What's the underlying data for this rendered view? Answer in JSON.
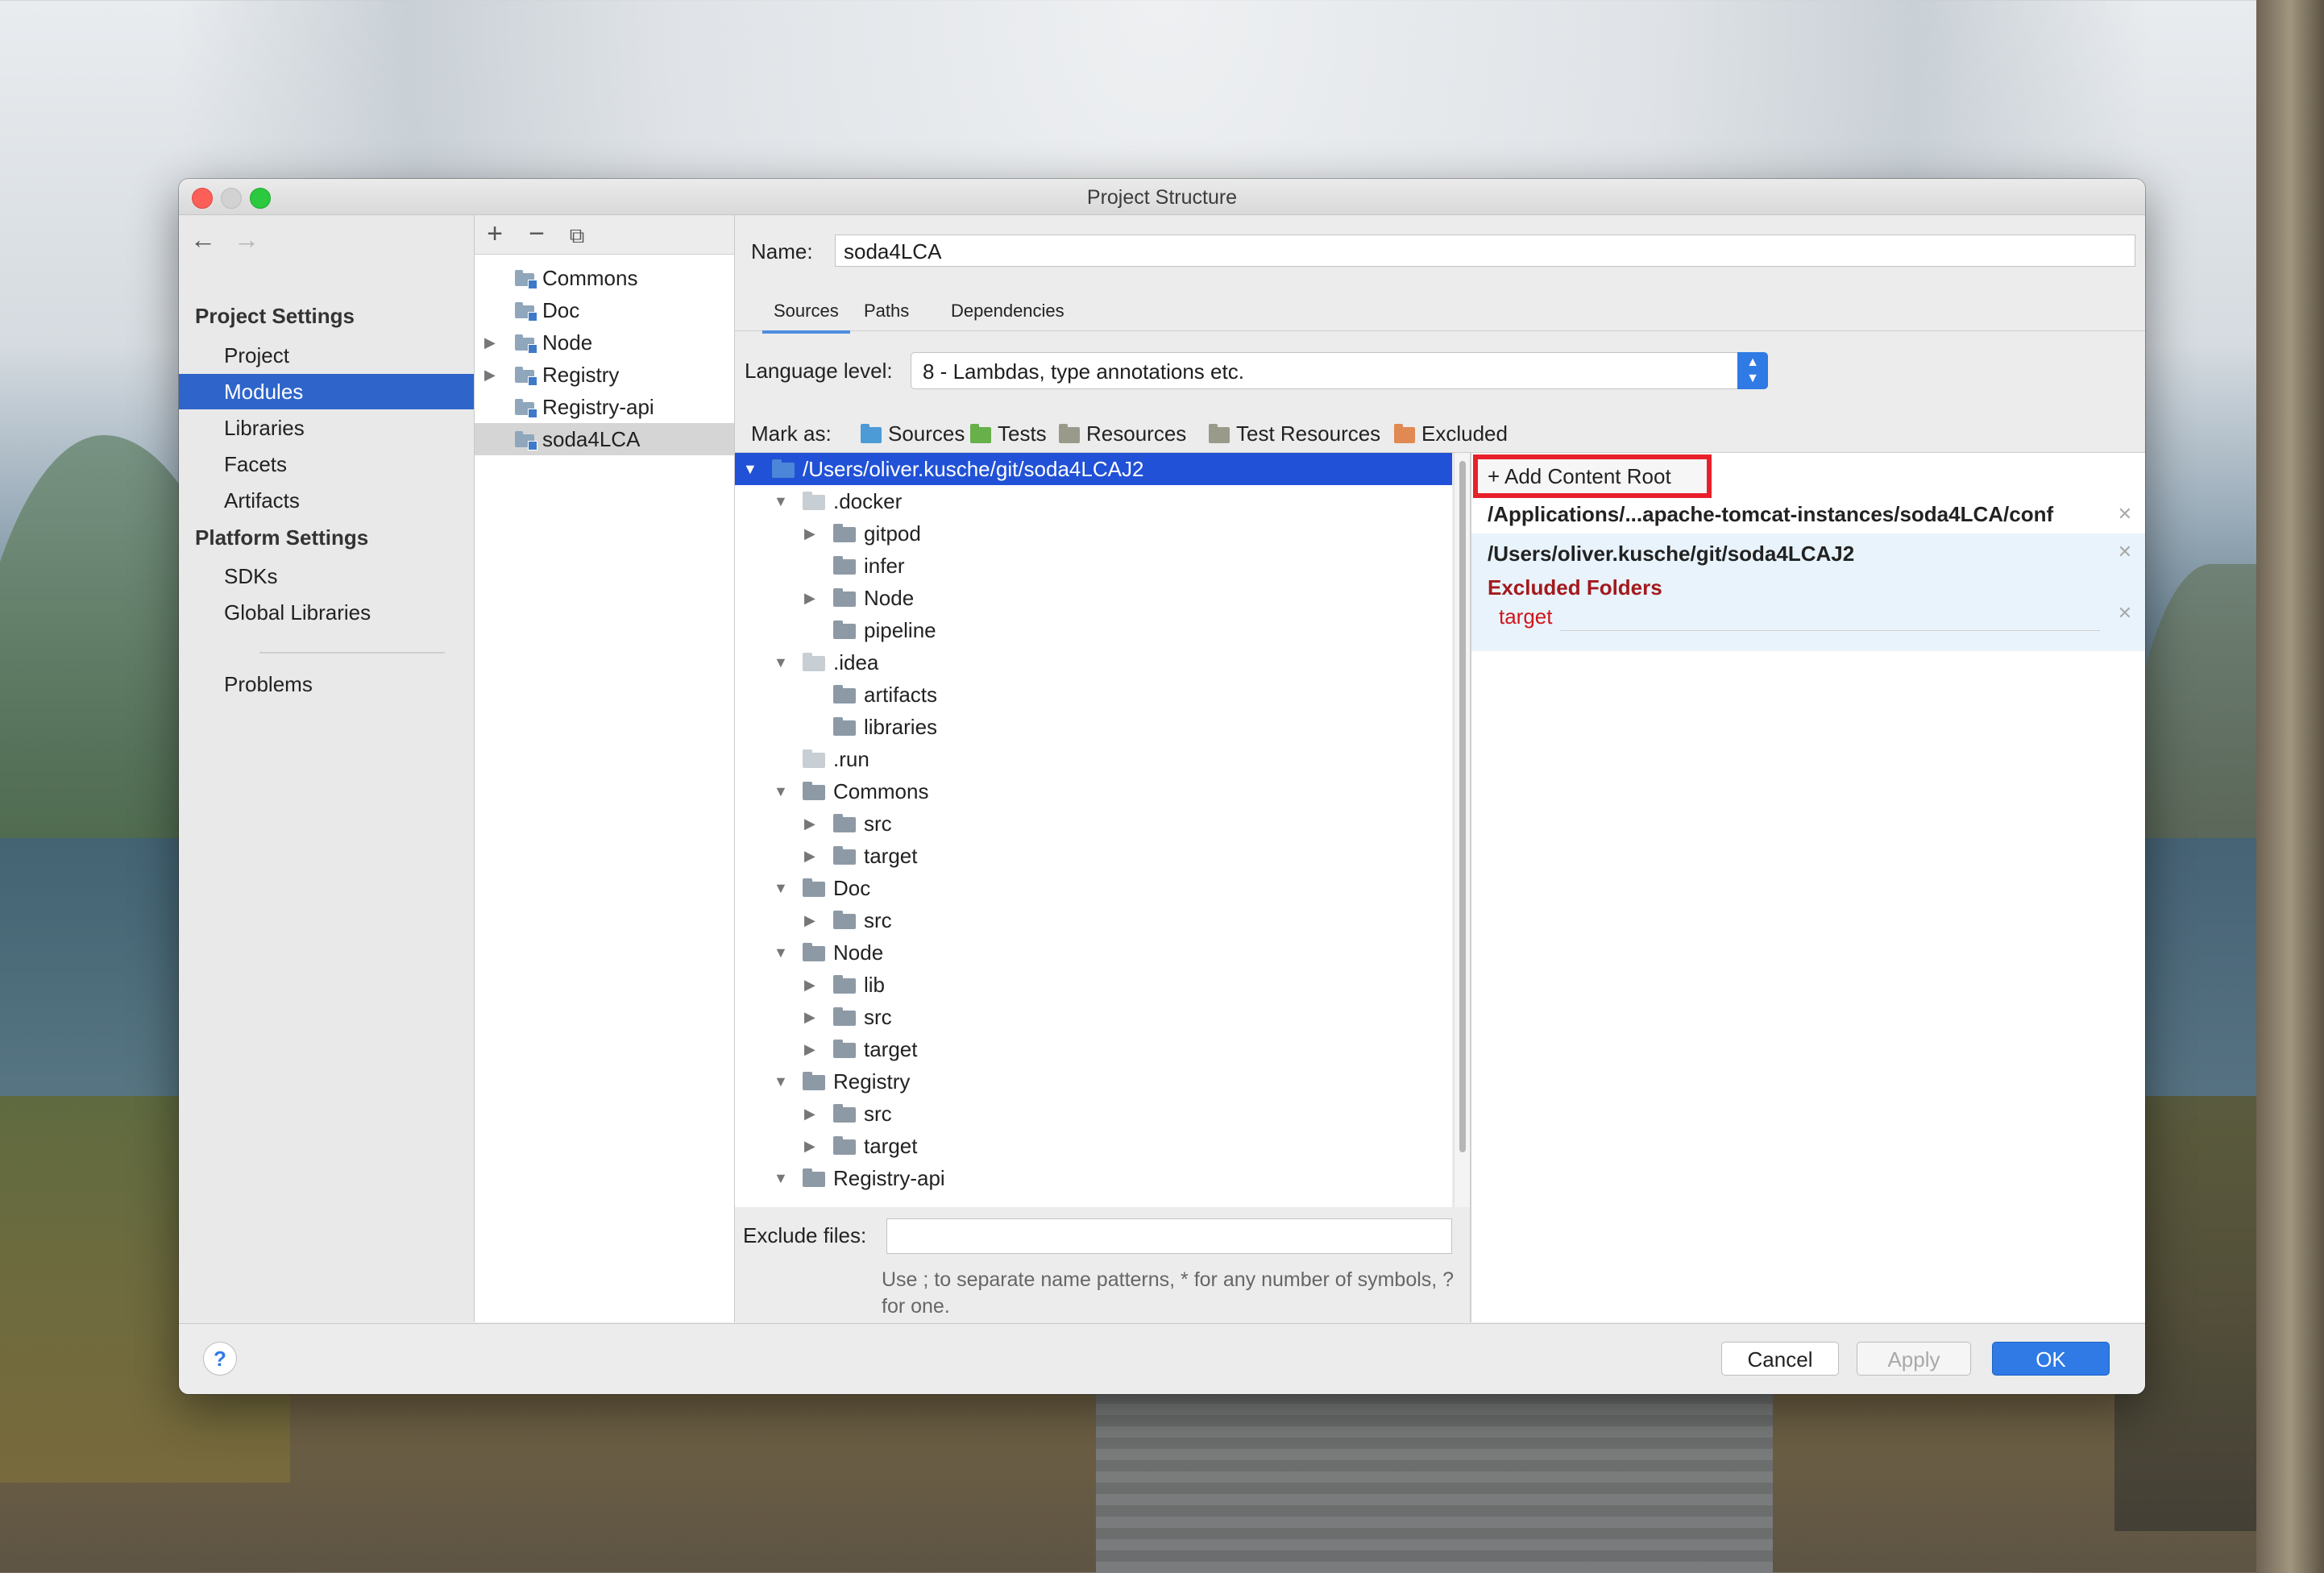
{
  "window": {
    "title": "Project Structure"
  },
  "nav": {
    "back_icon": "arrow-left-icon",
    "forward_icon": "arrow-right-icon",
    "project_settings_header": "Project Settings",
    "project_settings_items": [
      "Project",
      "Modules",
      "Libraries",
      "Facets",
      "Artifacts"
    ],
    "platform_settings_header": "Platform Settings",
    "platform_settings_items": [
      "SDKs",
      "Global Libraries"
    ],
    "problems": "Problems",
    "selected": "Modules"
  },
  "modules_toolbar": {
    "add": "+",
    "remove": "−",
    "copy_icon": "copy-icon"
  },
  "modules": [
    {
      "label": "Commons",
      "expandable": false
    },
    {
      "label": "Doc",
      "expandable": false
    },
    {
      "label": "Node",
      "expandable": true
    },
    {
      "label": "Registry",
      "expandable": true
    },
    {
      "label": "Registry-api",
      "expandable": false
    },
    {
      "label": "soda4LCA",
      "expandable": false,
      "selected": true
    }
  ],
  "module": {
    "name_label": "Name:",
    "name_value": "soda4LCA",
    "tabs": [
      "Sources",
      "Paths",
      "Dependencies"
    ],
    "active_tab": "Sources",
    "language_level_label": "Language level:",
    "language_level_value": "8 - Lambdas, type annotations etc.",
    "mark_as_label": "Mark as:",
    "mark_as": [
      {
        "label": "Sources",
        "color": "#4c9ad6"
      },
      {
        "label": "Tests",
        "color": "#67b04a"
      },
      {
        "label": "Resources",
        "color": "#9a9a8a"
      },
      {
        "label": "Test Resources",
        "color": "#9a9a8a"
      },
      {
        "label": "Excluded",
        "color": "#e08952"
      }
    ]
  },
  "tree": [
    {
      "label": "/Users/oliver.kusche/git/soda4LCAJ2",
      "level": 0,
      "state": "open",
      "folder": "blue",
      "selected": true
    },
    {
      "label": ".docker",
      "level": 1,
      "state": "open",
      "folder": "light"
    },
    {
      "label": "gitpod",
      "level": 2,
      "state": "closed",
      "folder": "normal"
    },
    {
      "label": "infer",
      "level": 2,
      "state": "none",
      "folder": "normal"
    },
    {
      "label": "Node",
      "level": 2,
      "state": "closed",
      "folder": "normal"
    },
    {
      "label": "pipeline",
      "level": 2,
      "state": "none",
      "folder": "normal"
    },
    {
      "label": ".idea",
      "level": 1,
      "state": "open",
      "folder": "light"
    },
    {
      "label": "artifacts",
      "level": 2,
      "state": "none",
      "folder": "normal"
    },
    {
      "label": "libraries",
      "level": 2,
      "state": "none",
      "folder": "normal"
    },
    {
      "label": ".run",
      "level": 1,
      "state": "none",
      "folder": "light"
    },
    {
      "label": "Commons",
      "level": 1,
      "state": "open",
      "folder": "normal"
    },
    {
      "label": "src",
      "level": 2,
      "state": "closed",
      "folder": "normal"
    },
    {
      "label": "target",
      "level": 2,
      "state": "closed",
      "folder": "normal"
    },
    {
      "label": "Doc",
      "level": 1,
      "state": "open",
      "folder": "normal"
    },
    {
      "label": "src",
      "level": 2,
      "state": "closed",
      "folder": "normal"
    },
    {
      "label": "Node",
      "level": 1,
      "state": "open",
      "folder": "normal"
    },
    {
      "label": "lib",
      "level": 2,
      "state": "closed",
      "folder": "normal"
    },
    {
      "label": "src",
      "level": 2,
      "state": "closed",
      "folder": "normal"
    },
    {
      "label": "target",
      "level": 2,
      "state": "closed",
      "folder": "normal"
    },
    {
      "label": "Registry",
      "level": 1,
      "state": "open",
      "folder": "normal"
    },
    {
      "label": "src",
      "level": 2,
      "state": "closed",
      "folder": "normal"
    },
    {
      "label": "target",
      "level": 2,
      "state": "closed",
      "folder": "normal"
    },
    {
      "label": "Registry-api",
      "level": 1,
      "state": "open",
      "folder": "normal"
    }
  ],
  "exclude": {
    "label": "Exclude files:",
    "value": "",
    "hint": "Use ; to separate name patterns, * for any number of symbols, ? for one."
  },
  "content_roots": {
    "add_button": "+ Add Content Root",
    "roots": [
      "/Applications/...apache-tomcat-instances/soda4LCA/conf",
      "/Users/oliver.kusche/git/soda4LCAJ2"
    ],
    "excluded_header": "Excluded Folders",
    "excluded_items": [
      "target"
    ]
  },
  "footer": {
    "help": "?",
    "cancel": "Cancel",
    "apply": "Apply",
    "ok": "OK"
  }
}
